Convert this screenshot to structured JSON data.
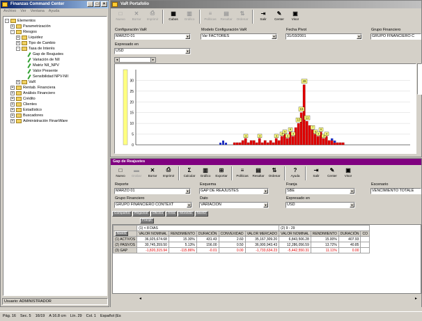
{
  "left_window": {
    "title": "Finanzas Command Center",
    "menu": [
      "Archivo",
      "Ver",
      "Ventana",
      "Ayuda"
    ],
    "tree": [
      {
        "level": 0,
        "expand": "-",
        "icon": "folder",
        "label": "Elementos"
      },
      {
        "level": 1,
        "expand": "+",
        "icon": "folder",
        "label": "Parametrización"
      },
      {
        "level": 1,
        "expand": "-",
        "icon": "folder",
        "label": "Riesgos"
      },
      {
        "level": 2,
        "expand": "+",
        "icon": "folder",
        "label": "Liquidez"
      },
      {
        "level": 2,
        "expand": "+",
        "icon": "folder",
        "label": "Tipo de Cambio"
      },
      {
        "level": 2,
        "expand": "-",
        "icon": "folder",
        "label": "Tasa de Interés"
      },
      {
        "level": 3,
        "expand": "",
        "icon": "pen",
        "label": "Gap de Reajustes"
      },
      {
        "level": 3,
        "expand": "",
        "icon": "pen",
        "label": "Variación de NII"
      },
      {
        "level": 3,
        "expand": "",
        "icon": "pen",
        "label": "Matriz NII_NPV"
      },
      {
        "level": 3,
        "expand": "",
        "icon": "pen",
        "label": "Valor Presente"
      },
      {
        "level": 3,
        "expand": "",
        "icon": "pen",
        "label": "Sensibilidad NPV-NII"
      },
      {
        "level": 2,
        "expand": "+",
        "icon": "folder",
        "label": "VaR"
      },
      {
        "level": 1,
        "expand": "+",
        "icon": "folder",
        "label": "Rentab. Financiera"
      },
      {
        "level": 1,
        "expand": "+",
        "icon": "folder",
        "label": "Análisis Financiero"
      },
      {
        "level": 1,
        "expand": "+",
        "icon": "folder",
        "label": "Crédito"
      },
      {
        "level": 1,
        "expand": "+",
        "icon": "folder",
        "label": "Clientes"
      },
      {
        "level": 1,
        "expand": "+",
        "icon": "folder",
        "label": "Estadístico"
      },
      {
        "level": 1,
        "expand": "+",
        "icon": "folder",
        "label": "Buscadores"
      },
      {
        "level": 1,
        "expand": "+",
        "icon": "folder",
        "label": "Administración FinanWare"
      }
    ],
    "status": "Usuario: ADMINISTRADOR"
  },
  "var_window": {
    "title": "VaR Portafolio",
    "toolbar": [
      {
        "label": "Nuevo",
        "icon": "new-icon",
        "glyph": "□",
        "enabled": false
      },
      {
        "label": "Borrar",
        "icon": "delete-icon",
        "glyph": "✕",
        "enabled": false
      },
      {
        "label": "Imprimir",
        "icon": "print-icon",
        "glyph": "⎙",
        "enabled": false
      },
      {
        "label": "Cubos",
        "icon": "cubes-icon",
        "glyph": "▦",
        "enabled": true
      },
      {
        "label": "Gráfico",
        "icon": "chart-icon",
        "glyph": "▥",
        "enabled": false
      },
      {
        "label": "Políticas",
        "icon": "policies-icon",
        "glyph": "≡",
        "enabled": false
      },
      {
        "label": "Resaltar",
        "icon": "highlight-icon",
        "glyph": "▤",
        "enabled": false
      },
      {
        "label": "Ordenar",
        "icon": "sort-icon",
        "glyph": "⇅",
        "enabled": false
      },
      {
        "label": "Salir",
        "icon": "exit-icon",
        "glyph": "⇥",
        "enabled": true
      },
      {
        "label": "Center",
        "icon": "center-icon",
        "glyph": "✎",
        "enabled": true
      },
      {
        "label": "Visor",
        "icon": "viewer-icon",
        "glyph": "▣",
        "enabled": true
      }
    ],
    "fields": {
      "config_label": "Configuración VaR",
      "config_value": "MARZO 01",
      "model_label": "Modelo Configuración VaR",
      "model_value": "Var FACTORES",
      "date_label": "Fecha Pivot",
      "date_value": "31/03/2001",
      "group_label": "Grupo Financiero",
      "group_value": "GRUPO FINANCIERO C",
      "currency_label": "Expresado en",
      "currency_value": "USD"
    }
  },
  "chart_data": {
    "type": "bar",
    "title": "",
    "xlabel": "",
    "ylabel": "",
    "ylim": [
      0,
      35
    ],
    "yticks": [
      0,
      5,
      10,
      15,
      20,
      25,
      30
    ],
    "series": [
      {
        "color": "#e00000",
        "values": [
          1,
          1,
          1,
          2,
          3,
          1,
          2,
          2,
          1,
          3,
          1,
          2,
          1,
          2,
          1,
          3,
          2,
          4,
          5,
          3,
          6,
          4,
          8,
          10,
          15,
          28,
          11,
          9,
          7,
          5,
          4,
          6,
          3,
          4,
          2,
          2,
          1,
          1,
          1,
          1
        ]
      },
      {
        "color": "#2030c0",
        "values": [
          0,
          0,
          0,
          0,
          0,
          0,
          0,
          0,
          0,
          0,
          0,
          0,
          0,
          0,
          0,
          0,
          0,
          0,
          0,
          0,
          0,
          0,
          0,
          0,
          0,
          0,
          0,
          0,
          0,
          0,
          0,
          0,
          0,
          0,
          0,
          1,
          1,
          0,
          0,
          0
        ]
      }
    ],
    "left_blue_cluster": [
      1,
      2,
      1
    ],
    "data_labels": [
      "28",
      "15",
      "11",
      "10"
    ]
  },
  "gap_window": {
    "title": "Gap de Reajustes",
    "toolbar": [
      {
        "label": "Nuevo",
        "icon": "new-icon",
        "glyph": "□",
        "enabled": true
      },
      {
        "label": "Grabar",
        "icon": "save-icon",
        "glyph": "▬",
        "enabled": false
      },
      {
        "label": "Borrar",
        "icon": "delete-icon",
        "glyph": "✕",
        "enabled": true
      },
      {
        "label": "Imprimir",
        "icon": "print-icon",
        "glyph": "⎙",
        "enabled": true
      },
      {
        "label": "Calcular",
        "icon": "calculate-icon",
        "glyph": "Σ",
        "enabled": true
      },
      {
        "label": "Gráfico",
        "icon": "chart-icon",
        "glyph": "▥",
        "enabled": true
      },
      {
        "label": "Exportar",
        "icon": "export-icon",
        "glyph": "⊞",
        "enabled": true
      },
      {
        "label": "Políticas",
        "icon": "policies-icon",
        "glyph": "≡",
        "enabled": true
      },
      {
        "label": "Resaltar",
        "icon": "highlight-icon",
        "glyph": "▤",
        "enabled": true
      },
      {
        "label": "Ordenar",
        "icon": "sort-icon",
        "glyph": "⇅",
        "enabled": true
      },
      {
        "label": "Ayuda",
        "icon": "help-icon",
        "glyph": "?",
        "enabled": true
      },
      {
        "label": "Salir",
        "icon": "exit-icon",
        "glyph": "⇥",
        "enabled": true
      },
      {
        "label": "Center",
        "icon": "center-icon",
        "glyph": "✎",
        "enabled": true
      },
      {
        "label": "Visor",
        "icon": "viewer-icon",
        "glyph": "▣",
        "enabled": true
      }
    ],
    "fields": {
      "report_label": "Reporte",
      "report_value": "MARZO 01",
      "scheme_label": "Esquema",
      "scheme_value": "GAP DE REAJUSTES",
      "band_label": "Franja",
      "band_value": "SBE",
      "scenario_label": "Escenario",
      "scenario_value": "VENCIMIENTO TOTALE",
      "group_label": "Grupo Financiero",
      "group_value": "GRUPO FINANCIERO CONTEXT",
      "data_label": "Dato",
      "data_value": "VARIACIÓN",
      "currency_label": "Expresado en",
      "currency_value": "USD"
    },
    "pivot_fields": [
      "Compañía",
      "Regional",
      "Oficina",
      "Área",
      "Moneda",
      "Nivel2"
    ],
    "pivot_row_field": "Nivel1",
    "pivot_col_field": "Franja",
    "col_groups": [
      "(1) < 8 DIAS",
      "(2) 9 - 29"
    ],
    "col_headers": [
      "VALOR NOMINAL",
      "RENDIMIENTO",
      "DURACIÓN",
      "CONVEXIDAD",
      "VALOR MERCADO",
      "VALOR NOMINAL",
      "RENDIMIENTO",
      "DURACIÓN",
      "CO"
    ],
    "rows": [
      {
        "label": "(1) ACTIVOS",
        "cells": [
          "36,925,674.68",
          "15.30%",
          "431.43",
          "2.60",
          "35,167,309.20",
          "6,843,506.28",
          "15.00%",
          "407.93",
          ""
        ],
        "neg": false
      },
      {
        "label": "(2) PASIVOS",
        "cells": [
          "30,745,359.50",
          "5.13%",
          "156.00",
          "0.50",
          "36,900,943.43",
          "12,286,056.59",
          "13.72%",
          "40.85",
          ""
        ],
        "neg": false
      },
      {
        "label": "(3) GAP",
        "cells": [
          "-1,820,315.94",
          "-115.86%",
          "-0.01",
          "0.00",
          "-1,733,634.23",
          "-5,442,550.31",
          "11.11%",
          "0.00",
          ""
        ],
        "neg": true
      }
    ]
  },
  "status_bar": {
    "items": [
      "Pág. 16",
      "Sec. 5",
      "16/19",
      "A 16.8 cm",
      "Lín. 29",
      "Col. 1",
      "Español (Es"
    ]
  }
}
